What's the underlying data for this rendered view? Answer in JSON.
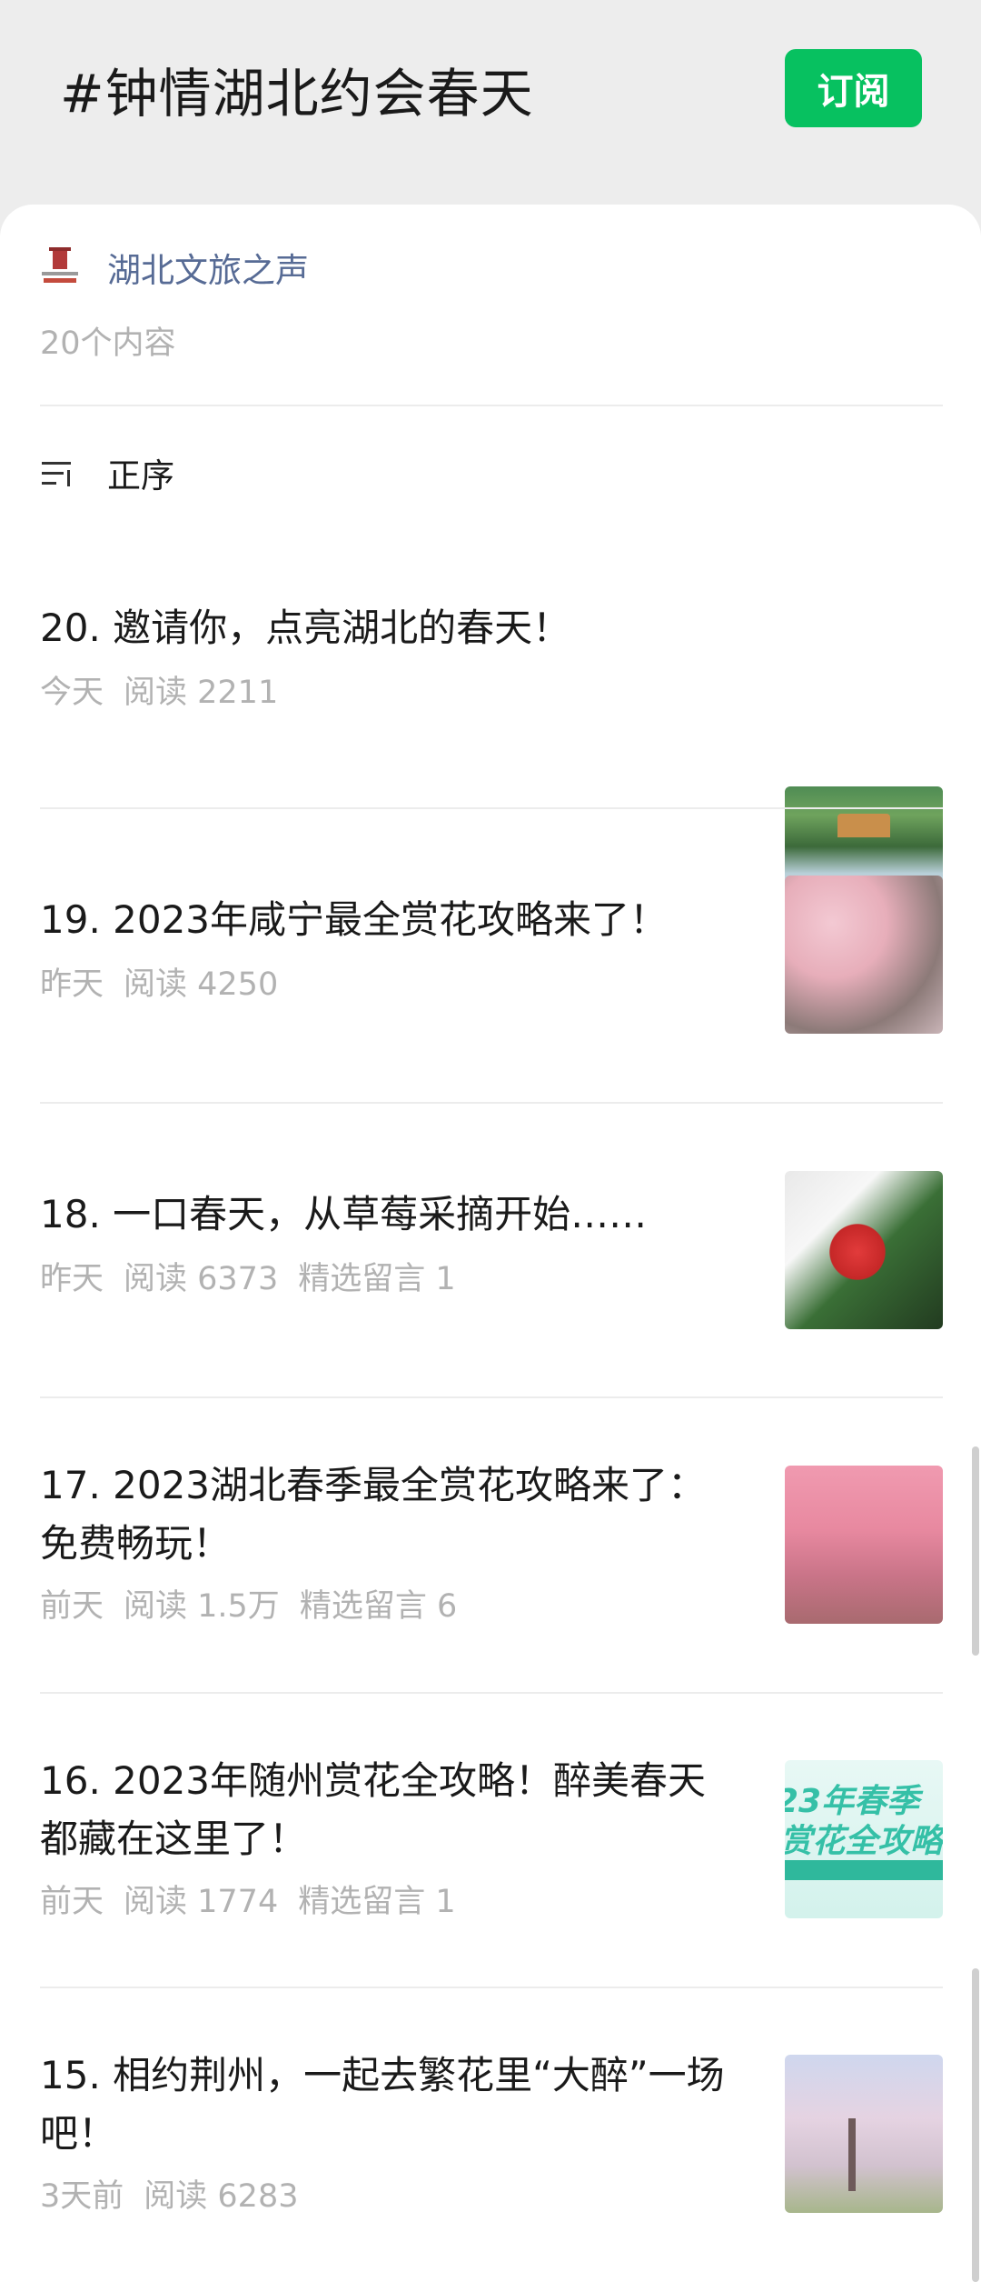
{
  "header": {
    "tag_title": "#钟情湖北约会春天",
    "subscribe_label": "订阅"
  },
  "account": {
    "name": "湖北文旅之声",
    "content_count": "20个内容"
  },
  "sort": {
    "label": "正序"
  },
  "articles": [
    {
      "title": "20. 邀请你，点亮湖北的春天！",
      "time": "今天",
      "reads": "阅读 2211",
      "comments": "",
      "thumb": "lake-pavilion"
    },
    {
      "title": "19. 2023年咸宁最全赏花攻略来了！",
      "time": "昨天",
      "reads": "阅读 4250",
      "comments": "",
      "thumb": "cherry-blossoms"
    },
    {
      "title": "18. 一口春天，从草莓采摘开始……",
      "time": "昨天",
      "reads": "阅读 6373",
      "comments": "精选留言 1",
      "thumb": "strawberries"
    },
    {
      "title": "17. 2023湖北春季最全赏花攻略来了：免费畅玩！",
      "time": "前天",
      "reads": "阅读 1.5万",
      "comments": "精选留言 6",
      "thumb": "pink-blossom-trees"
    },
    {
      "title": "16. 2023年随州赏花全攻略！醉美春天都藏在这里了！",
      "time": "前天",
      "reads": "阅读 1774",
      "comments": "精选留言 1",
      "thumb": "poster",
      "poster_line1": "23年春季",
      "poster_line2": "赏花全攻略"
    },
    {
      "title": "15. 相约荆州，一起去繁花里“大醉”一场吧！",
      "time": "3天前",
      "reads": "阅读 6283",
      "comments": "",
      "thumb": "blossom-tree"
    }
  ]
}
